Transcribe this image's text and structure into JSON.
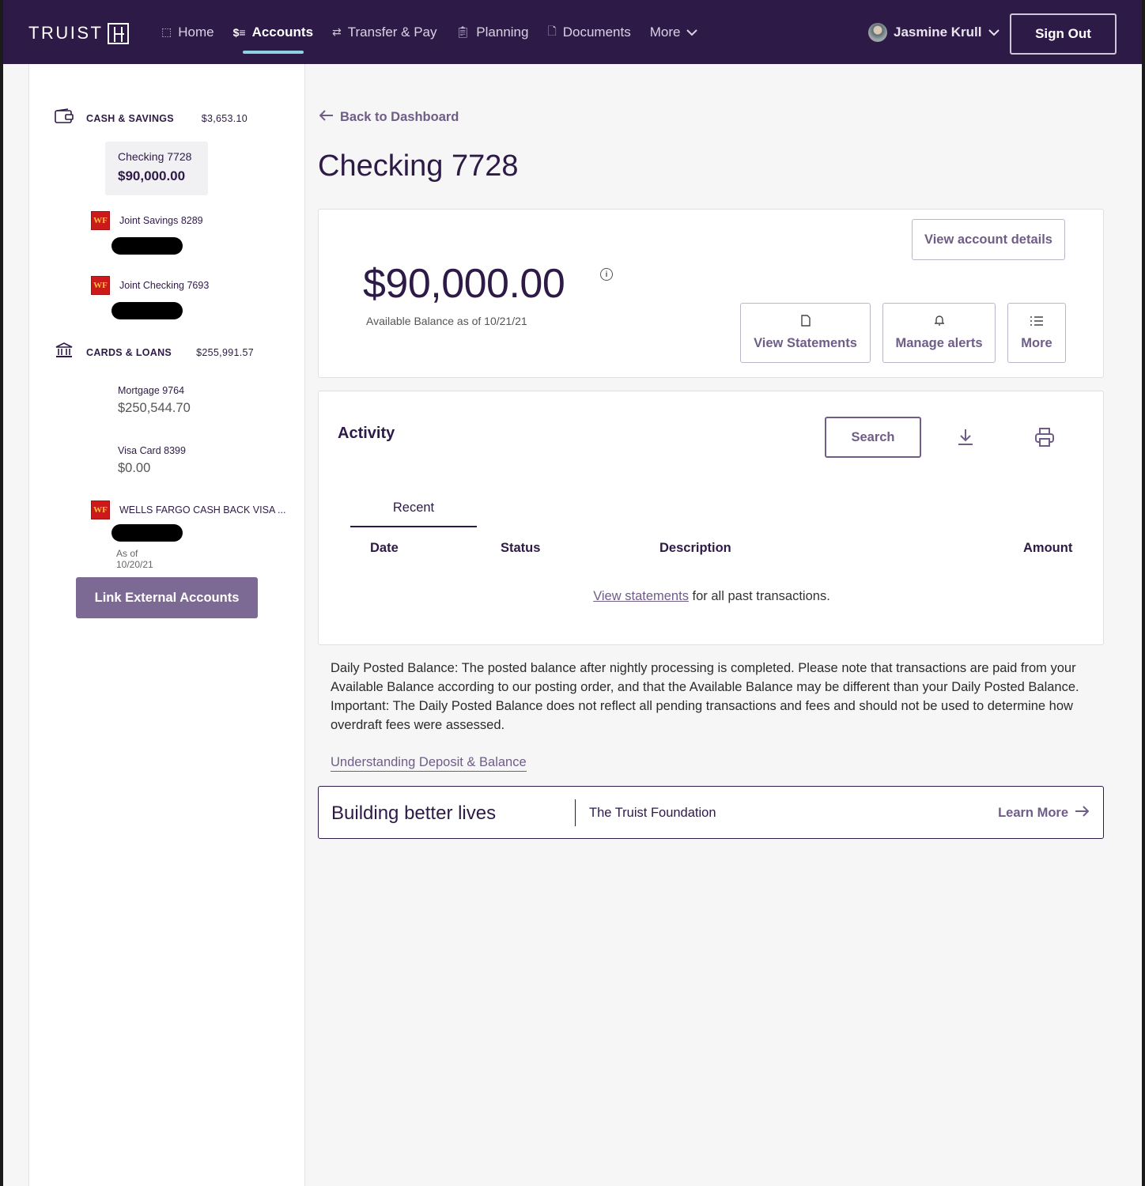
{
  "brand": {
    "name": "TRUIST"
  },
  "nav": {
    "items": [
      {
        "label": "Home",
        "icon": "home-icon"
      },
      {
        "label": "Accounts",
        "icon": "accounts-icon",
        "active": true
      },
      {
        "label": "Transfer & Pay",
        "icon": "transfer-icon"
      },
      {
        "label": "Planning",
        "icon": "planning-icon"
      },
      {
        "label": "Documents",
        "icon": "documents-icon"
      },
      {
        "label": "More",
        "icon": "chevron-down-icon"
      }
    ],
    "user": "Jasmine Krull",
    "signout": "Sign Out"
  },
  "sidebar": {
    "cash": {
      "title": "CASH & SAVINGS",
      "total": "$3,653.10"
    },
    "selected_account": {
      "name": "Checking 7728",
      "balance": "$90,000.00"
    },
    "external": [
      {
        "badge": "WF",
        "name": "Joint Savings 8289"
      },
      {
        "badge": "WF",
        "name": "Joint Checking 7693"
      }
    ],
    "cards": {
      "title": "CARDS & LOANS",
      "total": "$255,991.57"
    },
    "loans": [
      {
        "name": "Mortgage 9764",
        "balance": "$250,544.70"
      },
      {
        "name": "Visa Card 8399",
        "balance": "$0.00"
      }
    ],
    "wf_card": {
      "badge": "WF",
      "name": "WELLS FARGO CASH BACK VISA ...",
      "asof": "As of 10/20/21"
    },
    "link_button": "Link External Accounts"
  },
  "main": {
    "back": "Back to Dashboard",
    "title": "Checking 7728",
    "balance": "$90,000.00",
    "balance_sub": "Available Balance as of 10/21/21",
    "info_glyph": "i",
    "view_details": "View account details",
    "actions": [
      {
        "label": "View Statements",
        "icon": "document-icon"
      },
      {
        "label": "Manage alerts",
        "icon": "bell-icon"
      },
      {
        "label": "More",
        "icon": "list-icon"
      }
    ],
    "activity": {
      "title": "Activity",
      "search": "Search",
      "tab": "Recent",
      "columns": [
        "Date",
        "Status",
        "Description",
        "Amount"
      ],
      "empty_link": "View statements",
      "empty_rest": " for all past transactions."
    },
    "disclaimer": "Daily Posted Balance: The posted balance after nightly processing is completed. Please note that transactions are paid from your Available Balance according to our posting order, and that the Available Balance may be different than your Daily Posted Balance. Important: The Daily Posted Balance does not reflect all pending transactions and fees and should not be used to determine how overdraft fees were assessed.",
    "understand_link": "Understanding Deposit & Balance",
    "promo": {
      "title": "Building better lives",
      "subtitle": "The Truist Foundation",
      "link": "Learn More"
    }
  },
  "colors": {
    "nav_bg": "#2e1a47",
    "accent": "#6f5d88",
    "underline": "#8fd0e3",
    "wf_red": "#cc1a1a"
  }
}
